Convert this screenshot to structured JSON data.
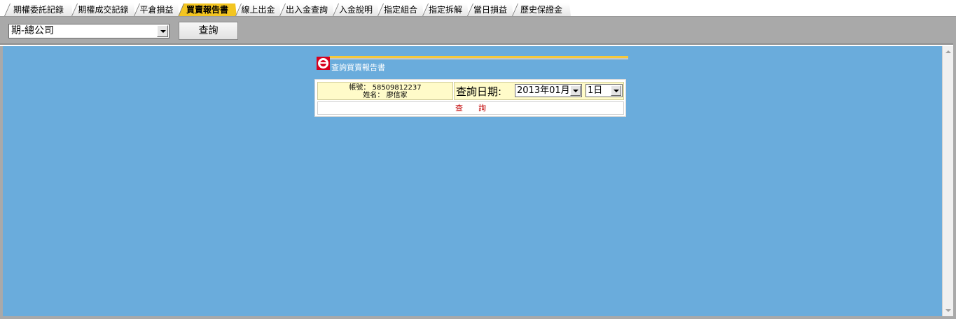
{
  "tabs": [
    {
      "label": "期權委託記錄"
    },
    {
      "label": "期權成交記錄"
    },
    {
      "label": "平倉損益"
    },
    {
      "label": "買賣報告書",
      "active": true
    },
    {
      "label": "線上出金"
    },
    {
      "label": "出入金查詢"
    },
    {
      "label": "入金說明"
    },
    {
      "label": "指定組合"
    },
    {
      "label": "指定拆解"
    },
    {
      "label": "當日損益"
    },
    {
      "label": "歷史保證金"
    }
  ],
  "toolbar": {
    "branch_value": "期-總公司",
    "query_label": "查詢"
  },
  "report": {
    "title": "查詢買賣報告書",
    "account_label": "帳號：",
    "account_value": "58509812237",
    "name_label": "姓名：",
    "name_value": "廖信家",
    "date_label": "查詢日期:",
    "month_value": "2013年01月",
    "day_value": "1日",
    "query_label": "查　　詢"
  },
  "colors": {
    "active_tab": "#f3c521",
    "content_bg": "#6aacdc",
    "toolbar_bg": "#a9a9a9",
    "info_bg": "#fffbc9",
    "query_text": "#c00000",
    "logo_red": "#d7001e"
  }
}
